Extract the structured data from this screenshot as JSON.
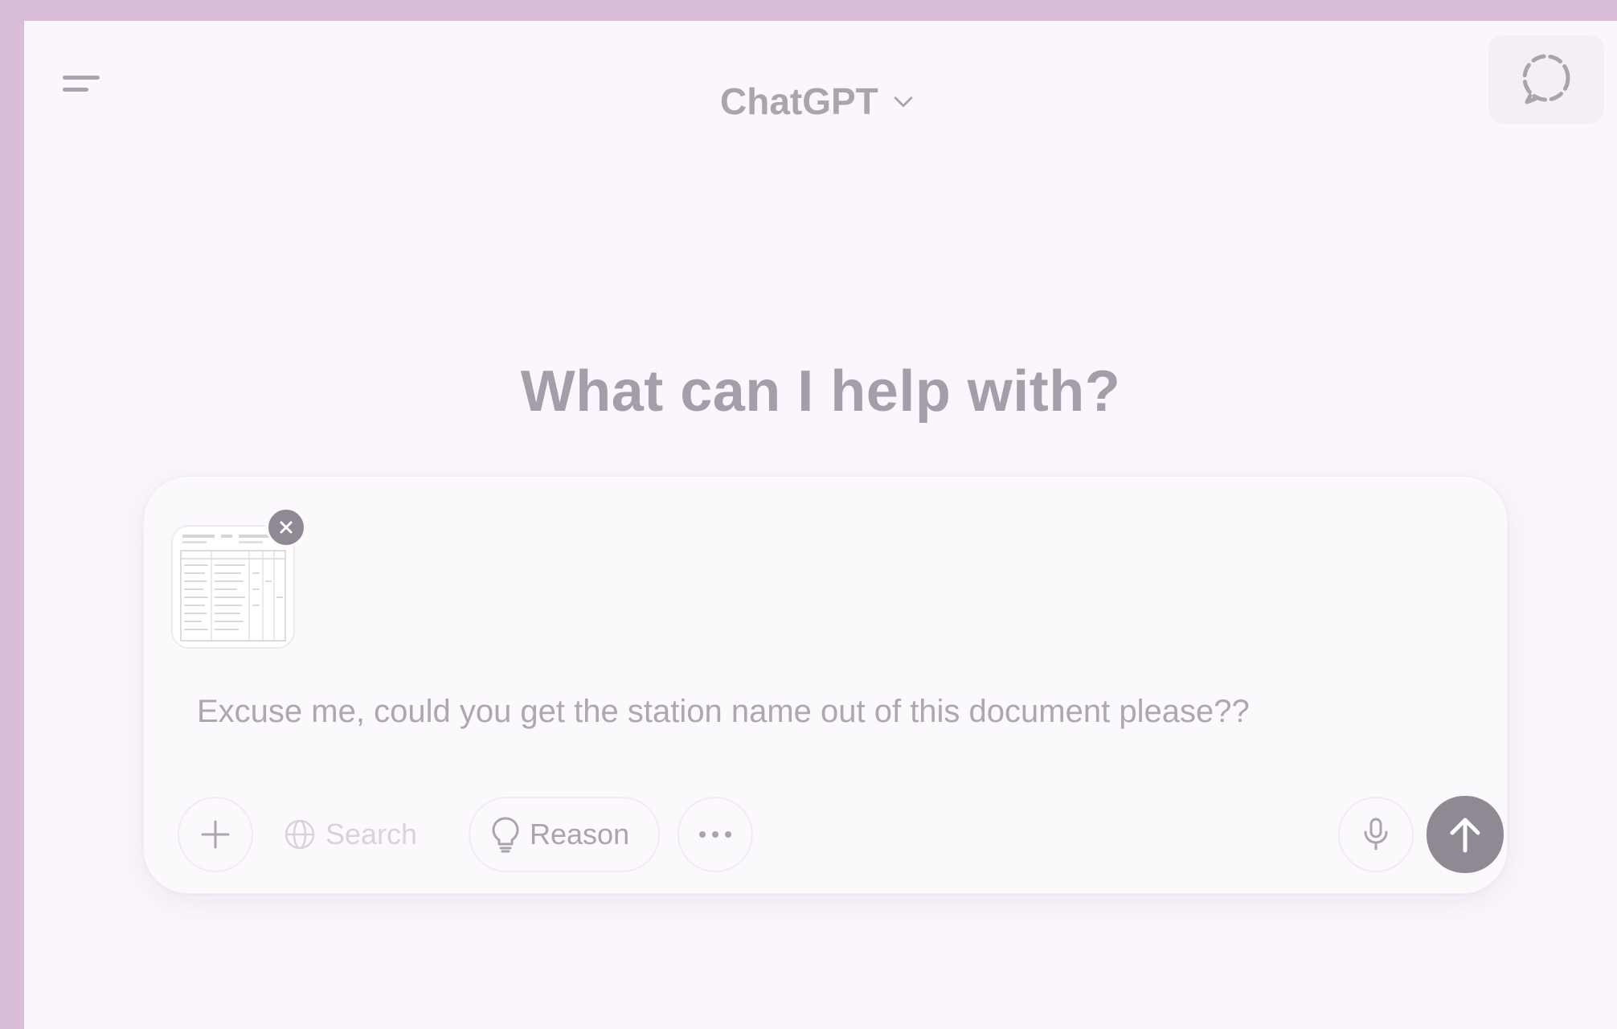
{
  "header": {
    "model_title": "ChatGPT",
    "icons": {
      "menu": "sidebar-toggle-icon",
      "chevron": "chevron-down-icon",
      "temporary_chat": "temporary-chat-icon"
    }
  },
  "hero": {
    "title": "What can I help with?"
  },
  "composer": {
    "attachment": {
      "type": "document-thumbnail",
      "remove_icon": "close-icon"
    },
    "prompt_value": "Excuse me, could you get the station name out of this document please??",
    "toolbar": {
      "add_icon": "plus-icon",
      "search_label": "Search",
      "search_icon": "globe-icon",
      "reason_label": "Reason",
      "reason_icon": "lightbulb-icon",
      "more_icon": "more-dots-icon",
      "mic_icon": "microphone-icon",
      "send_icon": "arrow-up-icon"
    }
  },
  "colors": {
    "frame_border": "#d8bcd8",
    "background": "#fbf6fd",
    "text_muted": "#a39ea8",
    "send_button": "#8e8993"
  }
}
